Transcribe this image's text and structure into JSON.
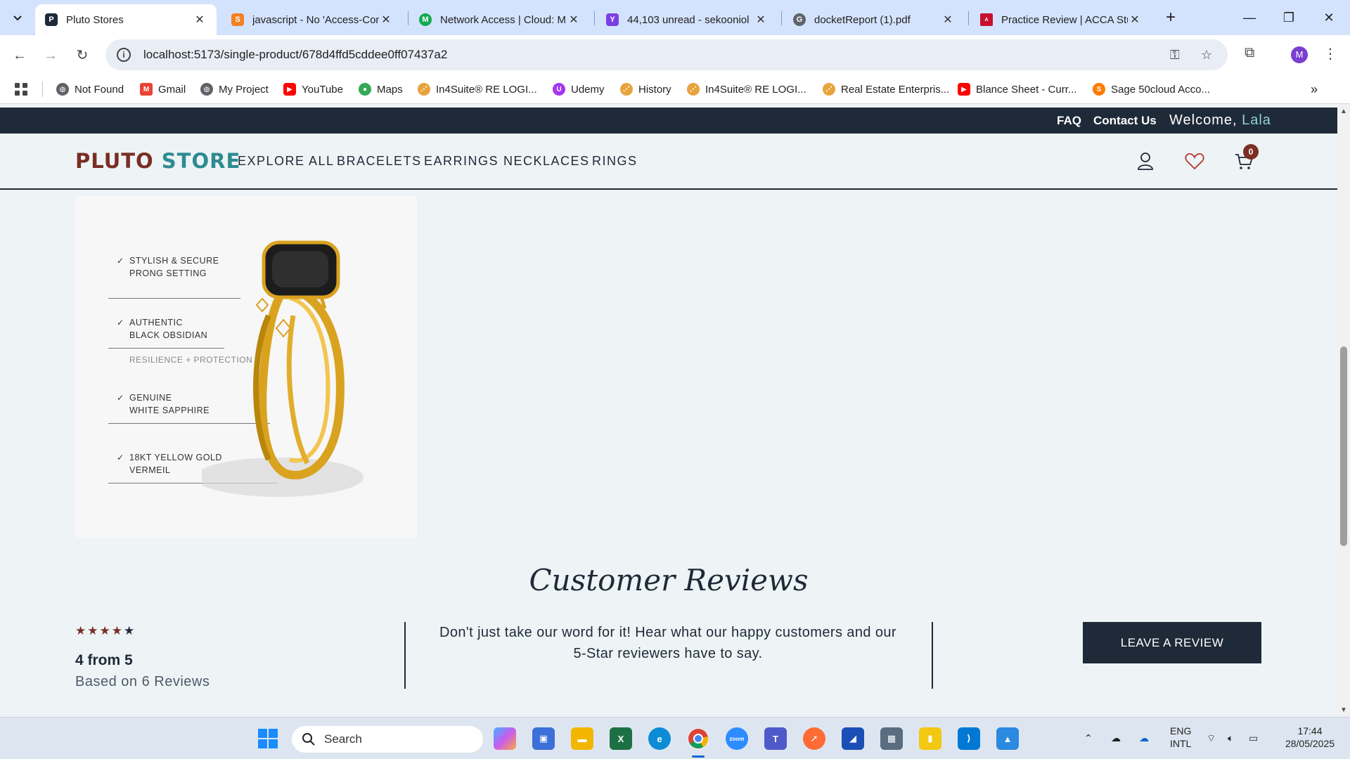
{
  "browser": {
    "tabs": [
      {
        "title": "Pluto Stores",
        "active": true,
        "favicon": "P",
        "favicon_color": "#1e2a38"
      },
      {
        "title": "javascript - No 'Access-Con",
        "active": false,
        "favicon": "S",
        "favicon_color": "#f48024"
      },
      {
        "title": "Network Access | Cloud: M",
        "active": false,
        "favicon": "M",
        "favicon_color": "#13aa52"
      },
      {
        "title": "44,103 unread - sekooniol",
        "active": false,
        "favicon": "Y",
        "favicon_color": "#7b3fe4"
      },
      {
        "title": "docketReport (1).pdf",
        "active": false,
        "favicon": "G",
        "favicon_color": "#5f6368"
      },
      {
        "title": "Practice Review | ACCA Stu",
        "active": false,
        "favicon": "A",
        "favicon_color": "#c8102e"
      }
    ],
    "url": "localhost:5173/single-product/678d4ffd5cddee0ff07437a2",
    "profile_initial": "M",
    "bookmarks": [
      {
        "label": "Not Found",
        "icon": "globe-icon",
        "color": "#5f6368"
      },
      {
        "label": "Gmail",
        "icon": "gmail-icon",
        "color": "#ea4335"
      },
      {
        "label": "My Project",
        "icon": "globe-icon",
        "color": "#5f6368"
      },
      {
        "label": "YouTube",
        "icon": "youtube-icon",
        "color": "#ff0000"
      },
      {
        "label": "Maps",
        "icon": "maps-icon",
        "color": "#34a853"
      },
      {
        "label": "In4Suite® RE LOGI...",
        "icon": "in4suite-icon",
        "color": "#e8a33d"
      },
      {
        "label": "Udemy",
        "icon": "udemy-icon",
        "color": "#a435f0"
      },
      {
        "label": "History",
        "icon": "in4suite-icon",
        "color": "#e8a33d"
      },
      {
        "label": "In4Suite® RE LOGI...",
        "icon": "in4suite-icon",
        "color": "#e8a33d"
      },
      {
        "label": "Real Estate Enterpris...",
        "icon": "in4suite-icon",
        "color": "#e8a33d"
      },
      {
        "label": "Blance Sheet - Curr...",
        "icon": "youtube-icon",
        "color": "#ff0000"
      },
      {
        "label": "Sage 50cloud Acco...",
        "icon": "sage-icon",
        "color": "#ff7a00"
      }
    ]
  },
  "site": {
    "topbar": {
      "faq": "FAQ",
      "contact": "Contact Us",
      "welcome": "Welcome,",
      "user": "Lala"
    },
    "logo": {
      "part1": "PLUTO",
      "part2": "STORE"
    },
    "nav": [
      "EXPLORE ALL",
      "BRACELETS",
      "EARRINGS",
      "NECKLACES",
      "RINGS"
    ],
    "cart_count": "0",
    "product_features": [
      {
        "line1": "STYLISH & SECURE",
        "line2": "PRONG SETTING"
      },
      {
        "line1": "AUTHENTIC",
        "line2": "BLACK OBSIDIAN",
        "sub": "RESILIENCE + PROTECTION"
      },
      {
        "line1": "GENUINE",
        "line2": "WHITE SAPPHIRE"
      },
      {
        "line1": "18KT YELLOW GOLD",
        "line2": "VERMEIL"
      }
    ],
    "reviews": {
      "title": "Customer Reviews",
      "stars": "★★★★",
      "last_star": "★",
      "summary": "4 from 5",
      "count": "Based on 6 Reviews",
      "blurb_line1": "Don't just take our word for it! Hear what our happy customers and our",
      "blurb_line2": "5-Star reviewers have to say.",
      "button": "LEAVE A REVIEW"
    }
  },
  "taskbar": {
    "search_placeholder": "Search",
    "lang_line1": "ENG",
    "lang_line2": "INTL",
    "time": "17:44",
    "date": "28/05/2025"
  }
}
